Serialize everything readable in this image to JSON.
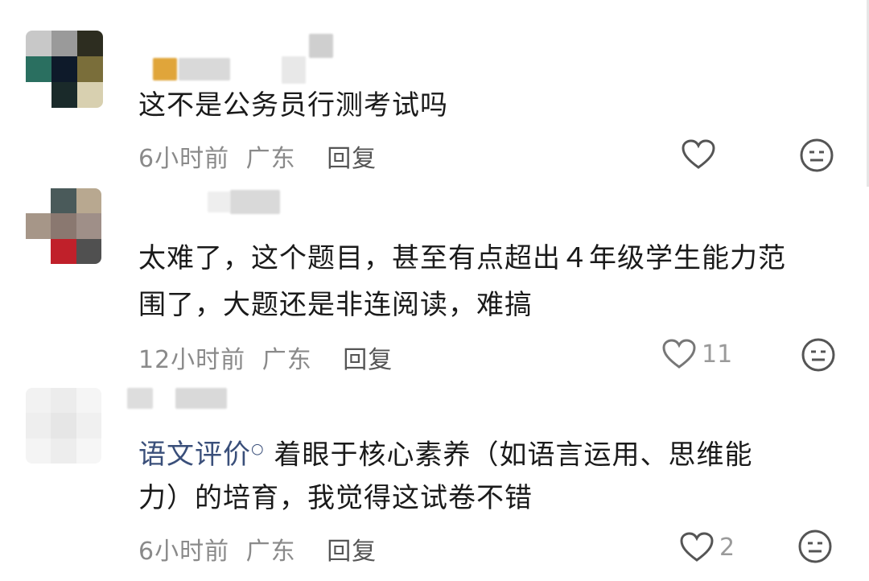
{
  "comments": [
    {
      "text": "这不是公务员行测考试吗",
      "time": "6小时前",
      "location": "广东",
      "reply": "回复",
      "likes": ""
    },
    {
      "text_line1": "太难了，这个题目，甚至有点超出４年级学生能力范",
      "text_line2": "围了，大题还是非连阅读，难搞",
      "time": "12小时前",
      "location": "广东",
      "reply": "回复",
      "likes": "11"
    },
    {
      "tag": "语文评价",
      "tag_icon": "search-icon",
      "text_line1": "着眼于核心素养（如语言运用、思维能",
      "text_line2": "力）的培育，我觉得这试卷不错",
      "time": "6小时前",
      "location": "广东",
      "reply": "回复",
      "likes": "2"
    }
  ]
}
